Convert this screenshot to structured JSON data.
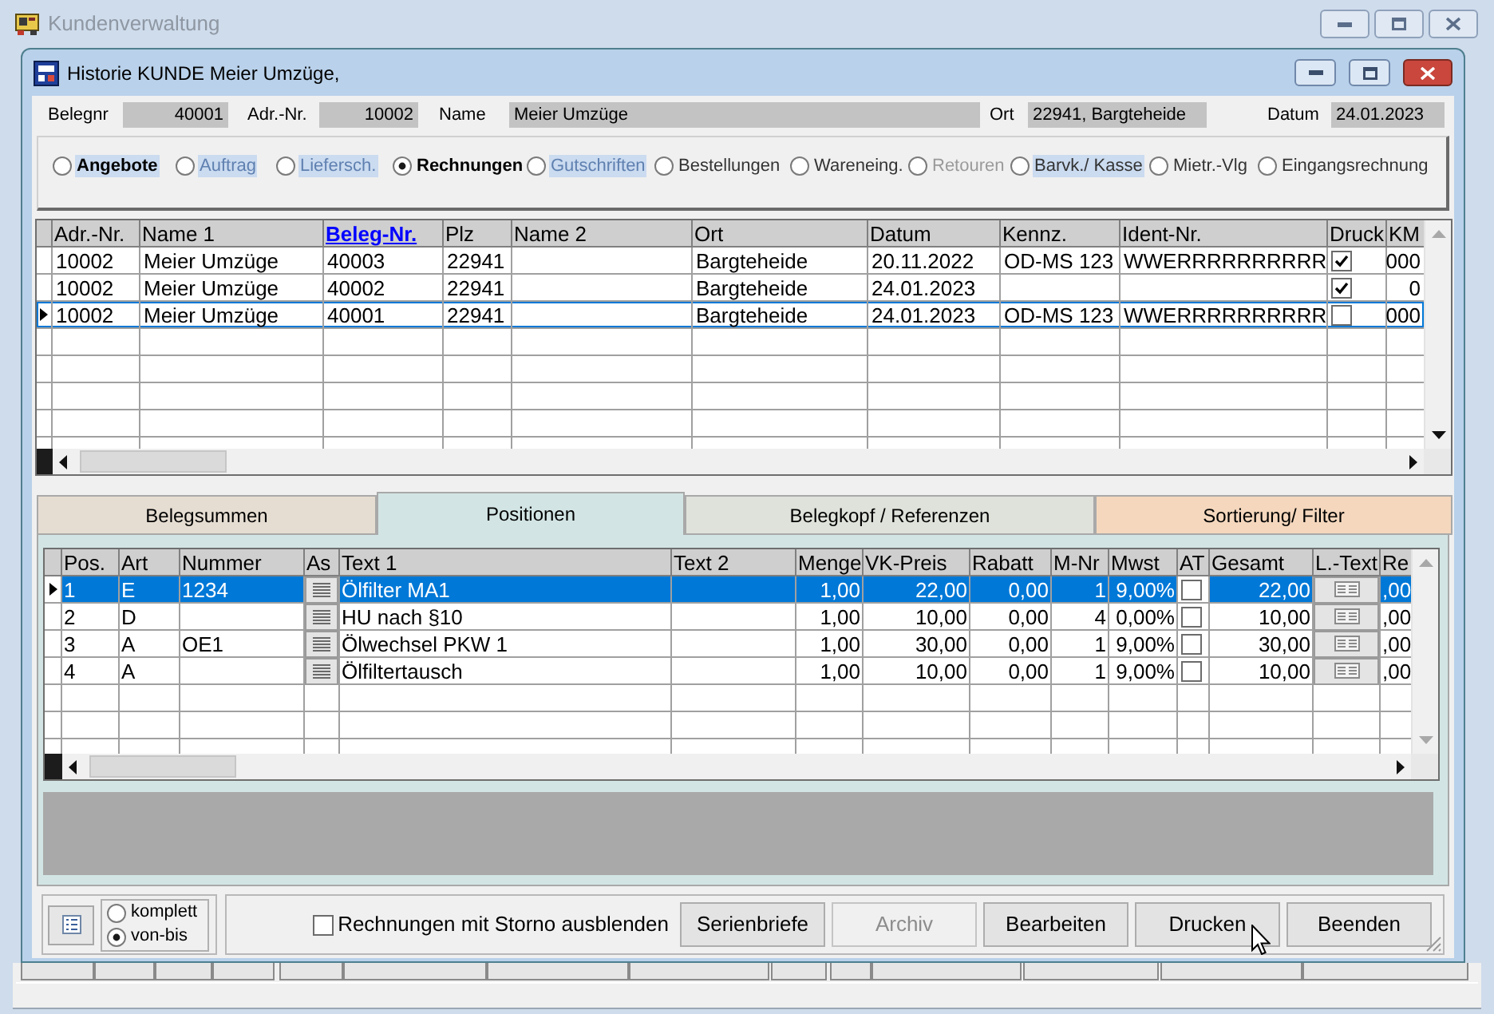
{
  "window": {
    "title": "Kundenverwaltung"
  },
  "child_window": {
    "title": "Historie KUNDE Meier Umzüge,"
  },
  "header_fields": [
    {
      "label": "Belegnr",
      "value": "40001",
      "kind": "number"
    },
    {
      "label": "Adr.-Nr.",
      "value": "10002",
      "kind": "number"
    },
    {
      "label": "Name",
      "value": "Meier Umzüge",
      "kind": "text"
    },
    {
      "label": "Ort",
      "value": "22941, Bargteheide",
      "kind": "text"
    },
    {
      "label": "Datum",
      "value": "24.01.2023",
      "kind": "text"
    }
  ],
  "document_types": [
    {
      "label": "Angebote",
      "selected": false,
      "highlighted": true,
      "emphasized": true,
      "dimmed": false,
      "disabled": false
    },
    {
      "label": "Auftrag",
      "selected": false,
      "highlighted": true,
      "emphasized": false,
      "dimmed": true,
      "disabled": false
    },
    {
      "label": "Liefersch.",
      "selected": false,
      "highlighted": true,
      "emphasized": false,
      "dimmed": true,
      "disabled": false
    },
    {
      "label": "Rechnungen",
      "selected": true,
      "highlighted": false,
      "emphasized": true,
      "dimmed": false,
      "disabled": false
    },
    {
      "label": "Gutschriften",
      "selected": false,
      "highlighted": true,
      "emphasized": false,
      "dimmed": true,
      "disabled": false
    },
    {
      "label": "Bestellungen",
      "selected": false,
      "highlighted": false,
      "emphasized": false,
      "dimmed": false,
      "disabled": false
    },
    {
      "label": "Wareneing.",
      "selected": false,
      "highlighted": false,
      "emphasized": false,
      "dimmed": false,
      "disabled": false
    },
    {
      "label": "Retouren",
      "selected": false,
      "highlighted": false,
      "emphasized": false,
      "dimmed": false,
      "disabled": true
    },
    {
      "label": "Barvk./ Kasse",
      "selected": false,
      "highlighted": true,
      "emphasized": false,
      "dimmed": false,
      "disabled": false
    },
    {
      "label": "Mietr.-Vlg",
      "selected": false,
      "highlighted": false,
      "emphasized": false,
      "dimmed": false,
      "disabled": false
    },
    {
      "label": "Eingangsrechnung",
      "selected": false,
      "highlighted": false,
      "emphasized": false,
      "dimmed": false,
      "disabled": false
    }
  ],
  "documents_table": {
    "columns": [
      {
        "label": "Adr.-Nr.",
        "kind": "text",
        "sorted": false
      },
      {
        "label": "Name 1",
        "kind": "text",
        "sorted": false
      },
      {
        "label": "Beleg-Nr.",
        "kind": "text",
        "sorted": true
      },
      {
        "label": "Plz",
        "kind": "text",
        "sorted": false
      },
      {
        "label": "Name 2",
        "kind": "text",
        "sorted": false
      },
      {
        "label": "Ort",
        "kind": "text",
        "sorted": false
      },
      {
        "label": "Datum",
        "kind": "text",
        "sorted": false
      },
      {
        "label": "Kennz.",
        "kind": "text",
        "sorted": false
      },
      {
        "label": "Ident-Nr.",
        "kind": "text",
        "sorted": false
      },
      {
        "label": "Druck",
        "kind": "check",
        "sorted": false
      },
      {
        "label": "KM",
        "kind": "number",
        "sorted": false
      }
    ],
    "rows": [
      {
        "selected": false,
        "cells": [
          "10002",
          "Meier Umzüge",
          "40003",
          "22941",
          null,
          "Bargteheide",
          "20.11.2022",
          "OD-MS 123",
          "WWERRRRRRRRRR",
          true,
          "000"
        ]
      },
      {
        "selected": false,
        "cells": [
          "10002",
          "Meier Umzüge",
          "40002",
          "22941",
          null,
          "Bargteheide",
          "24.01.2023",
          null,
          null,
          true,
          "0"
        ]
      },
      {
        "selected": true,
        "cells": [
          "10002",
          "Meier Umzüge",
          "40001",
          "22941",
          null,
          "Bargteheide",
          "24.01.2023",
          "OD-MS 123",
          "WWERRRRRRRRRR",
          false,
          "000"
        ]
      }
    ]
  },
  "tabs": [
    {
      "label": "Belegsummen",
      "selected": false,
      "color": "#e6ddd2"
    },
    {
      "label": "Positionen",
      "selected": true,
      "color": "#d2e5e4"
    },
    {
      "label": "Belegkopf / Referenzen",
      "selected": false,
      "color": "#dfe2da"
    },
    {
      "label": "Sortierung/ Filter",
      "selected": false,
      "color": "#f4d7bd"
    }
  ],
  "positions_table": {
    "columns": [
      {
        "label": "Pos.",
        "kind": "text"
      },
      {
        "label": "Art",
        "kind": "text"
      },
      {
        "label": "Nummer",
        "kind": "text"
      },
      {
        "label": "As",
        "kind": "button"
      },
      {
        "label": "Text 1",
        "kind": "text"
      },
      {
        "label": "Text 2",
        "kind": "text"
      },
      {
        "label": "Menge",
        "kind": "number"
      },
      {
        "label": "VK-Preis",
        "kind": "number"
      },
      {
        "label": "Rabatt",
        "kind": "number"
      },
      {
        "label": "M-Nr",
        "kind": "number"
      },
      {
        "label": "Mwst",
        "kind": "number"
      },
      {
        "label": "AT",
        "kind": "check"
      },
      {
        "label": "Gesamt",
        "kind": "number"
      },
      {
        "label": "L.-Text",
        "kind": "button"
      },
      {
        "label": "Re",
        "kind": "text"
      }
    ],
    "rows": [
      {
        "selected": true,
        "cells": [
          "1",
          "E",
          "1234",
          true,
          "Ölfilter MA1",
          null,
          "1,00",
          "22,00",
          "0,00",
          "1",
          "9,00%",
          false,
          "22,00",
          true,
          ",00"
        ]
      },
      {
        "selected": false,
        "cells": [
          "2",
          "D",
          null,
          true,
          "HU nach §10",
          null,
          "1,00",
          "10,00",
          "0,00",
          "4",
          "0,00%",
          false,
          "10,00",
          true,
          ",00"
        ]
      },
      {
        "selected": false,
        "cells": [
          "3",
          "A",
          "OE1",
          true,
          "Ölwechsel PKW 1",
          null,
          "1,00",
          "30,00",
          "0,00",
          "1",
          "9,00%",
          false,
          "30,00",
          true,
          ",00"
        ]
      },
      {
        "selected": false,
        "cells": [
          "4",
          "A",
          null,
          true,
          "Ölfiltertausch",
          null,
          "1,00",
          "10,00",
          "0,00",
          "1",
          "9,00%",
          false,
          "10,00",
          true,
          ",00"
        ]
      }
    ]
  },
  "range_options": [
    {
      "label": "komplett",
      "selected": false
    },
    {
      "label": "von-bis",
      "selected": true
    }
  ],
  "storno_filter": {
    "label": "Rechnungen mit Storno ausblenden",
    "checked": false
  },
  "buttons": [
    {
      "label": "Serienbriefe",
      "disabled": false
    },
    {
      "label": "Archiv",
      "disabled": true
    },
    {
      "label": "Bearbeiten",
      "disabled": false
    },
    {
      "label": "Drucken",
      "disabled": false
    },
    {
      "label": "Beenden",
      "disabled": false
    }
  ]
}
